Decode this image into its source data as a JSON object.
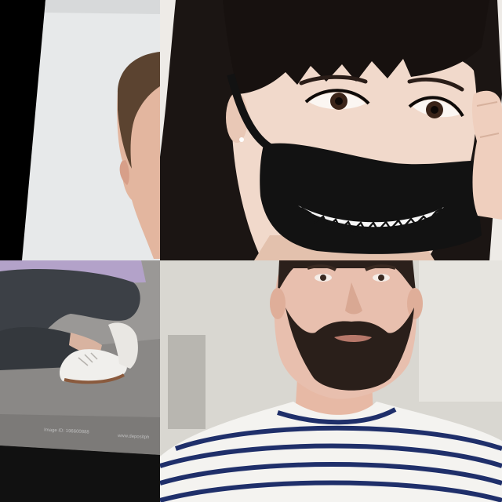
{
  "collage": {
    "tiles": [
      {
        "id": "top-left",
        "subject": "young man with short brown hair, partially cropped, tilted photo"
      },
      {
        "id": "top-right",
        "subject": "woman with black bangs wearing a black face mask printed with a toothy grin"
      },
      {
        "id": "bottom-left",
        "subject": "person crouching in grey jeans and white lace-up shoes on gravel, stock photo strip"
      },
      {
        "id": "bottom-right",
        "subject": "bearded man in a navy and white striped shirt"
      }
    ],
    "stock_caption": {
      "image_id": "Image ID: 196600888",
      "site": "www.depositph"
    }
  },
  "colors": {
    "mask": "#121212",
    "hair": "#1b1513",
    "skin_light": "#f1d9cb",
    "stripe_navy": "#1f2f6a",
    "background": "#000000"
  }
}
